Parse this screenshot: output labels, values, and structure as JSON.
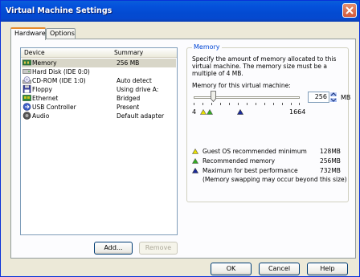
{
  "window": {
    "title": "Virtual Machine Settings"
  },
  "tabs": [
    {
      "label": "Hardware"
    },
    {
      "label": "Options"
    }
  ],
  "device_list": {
    "columns": {
      "device": "Device",
      "summary": "Summary"
    },
    "rows": [
      {
        "name": "Memory",
        "summary": "256 MB",
        "icon": "memory-icon"
      },
      {
        "name": "Hard Disk (IDE 0:0)",
        "summary": "",
        "icon": "hard-disk-icon"
      },
      {
        "name": "CD-ROM (IDE 1:0)",
        "summary": "Auto detect",
        "icon": "cdrom-icon"
      },
      {
        "name": "Floppy",
        "summary": "Using drive A:",
        "icon": "floppy-icon"
      },
      {
        "name": "Ethernet",
        "summary": "Bridged",
        "icon": "ethernet-icon"
      },
      {
        "name": "USB Controller",
        "summary": "Present",
        "icon": "usb-icon"
      },
      {
        "name": "Audio",
        "summary": "Default adapter",
        "icon": "audio-icon"
      }
    ]
  },
  "buttons": {
    "add": "Add...",
    "remove": "Remove",
    "ok": "OK",
    "cancel": "Cancel",
    "help": "Help"
  },
  "memory": {
    "group_title": "Memory",
    "description": "Specify the amount of memory allocated to this virtual machine. The memory size must be a multiple of 4 MB.",
    "field_label": "Memory for this virtual machine:",
    "value": "256",
    "unit": "MB",
    "scale_min": "4",
    "scale_max": "1664",
    "legend": [
      {
        "label": "Guest OS recommended minimum",
        "value": "128MB",
        "color": "#e8e000"
      },
      {
        "label": "Recommended memory",
        "value": "256MB",
        "color": "#33aa22"
      },
      {
        "label": "Maximum for best performance",
        "value": "732MB",
        "color": "#1a2b9c"
      }
    ],
    "note": "(Memory swapping may occur beyond this size)"
  }
}
